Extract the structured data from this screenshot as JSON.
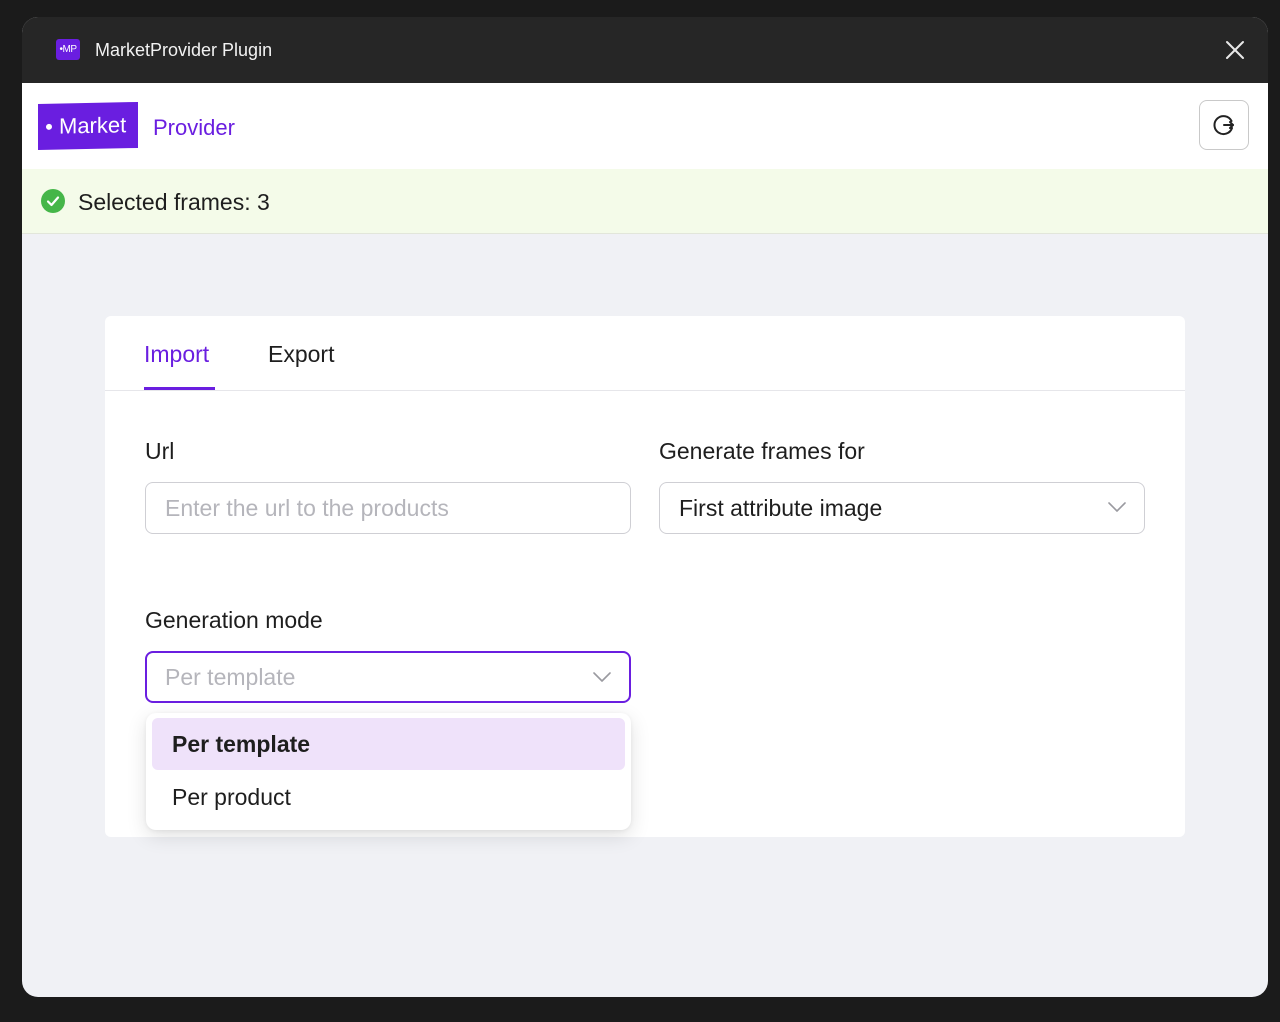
{
  "window": {
    "title": "MarketProvider Plugin",
    "logo_text": "•MP"
  },
  "brand": {
    "market": "Market",
    "provider": "Provider"
  },
  "status": {
    "text": "Selected frames: 3",
    "color": "#45b649"
  },
  "tabs": [
    {
      "label": "Import",
      "active": true
    },
    {
      "label": "Export",
      "active": false
    }
  ],
  "form": {
    "url": {
      "label": "Url",
      "placeholder": "Enter the url to the products",
      "value": ""
    },
    "generate_for": {
      "label": "Generate frames for",
      "value": "First attribute image"
    },
    "generation_mode": {
      "label": "Generation mode",
      "value": "Per template",
      "options": [
        {
          "label": "Per template",
          "selected": true
        },
        {
          "label": "Per product",
          "selected": false
        }
      ]
    }
  },
  "icons": {
    "close": "close-icon",
    "refresh": "refresh-icon",
    "status": "check-circle-icon",
    "dropdown": "chevron-down-icon"
  },
  "colors": {
    "accent": "#6a1ee0",
    "titlebar": "#262626",
    "status_bg": "#f4fbe9",
    "selected_option_bg": "#efe2fa"
  }
}
